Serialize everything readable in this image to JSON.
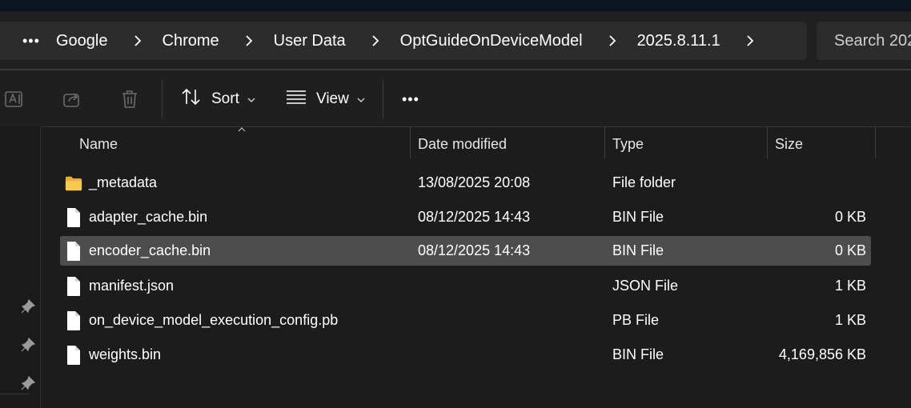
{
  "breadcrumb": {
    "overflow_label": "•••",
    "items": [
      "Google",
      "Chrome",
      "User Data",
      "OptGuideOnDeviceModel",
      "2025.8.11.1"
    ]
  },
  "search": {
    "placeholder": "Search 202"
  },
  "toolbar": {
    "sort_label": "Sort",
    "view_label": "View",
    "more_label": "•••",
    "icons": [
      "rename-icon",
      "share-icon",
      "delete-icon"
    ]
  },
  "columns": {
    "name": "Name",
    "date": "Date modified",
    "type": "Type",
    "size": "Size"
  },
  "files": [
    {
      "name": "_metadata",
      "date": "13/08/2025 20:08",
      "type": "File folder",
      "size": "",
      "icon": "folder-icon"
    },
    {
      "name": "adapter_cache.bin",
      "date": "08/12/2025 14:43",
      "type": "BIN File",
      "size": "0 KB",
      "icon": "file-icon"
    },
    {
      "name": "encoder_cache.bin",
      "date": "08/12/2025 14:43",
      "type": "BIN File",
      "size": "0 KB",
      "icon": "file-icon",
      "selected": true
    },
    {
      "name": "manifest.json",
      "date": "",
      "type": "JSON File",
      "size": "1 KB",
      "icon": "file-icon"
    },
    {
      "name": "on_device_model_execution_config.pb",
      "date": "",
      "type": "PB File",
      "size": "1 KB",
      "icon": "file-icon"
    },
    {
      "name": "weights.bin",
      "date": "",
      "type": "BIN File",
      "size": "4,169,856 KB",
      "icon": "file-icon"
    }
  ],
  "colors": {
    "background": "#1c1c1c",
    "selected_row": "#4d4d4d",
    "folder": "#f5c04a"
  }
}
